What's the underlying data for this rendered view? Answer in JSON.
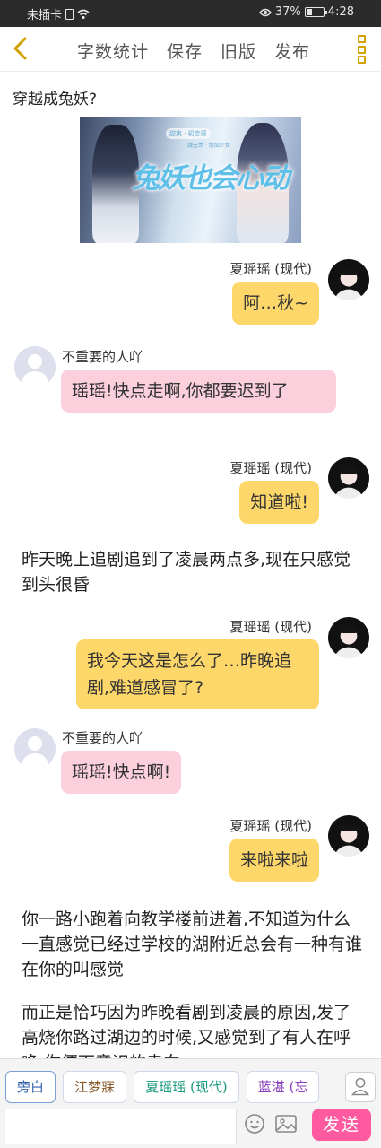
{
  "status_bar": {
    "carrier": "未插卡",
    "battery": "37%",
    "battery_level": 0.37,
    "time": "4:28"
  },
  "toolbar": {
    "back_icon": "chevron-left-icon",
    "actions": [
      "字数统计",
      "保存",
      "旧版",
      "发布"
    ],
    "more_icon": "more-vertical-icon",
    "accent_color": "#d3a200"
  },
  "story": {
    "title": "穿越成兔妖?",
    "cover_title": "兔妖也会心动",
    "cover_subtitle": "甜爽 · 初恋感",
    "cover_subtitle2": "魏无羡 · 兔仙少女"
  },
  "messages": [
    {
      "type": "right",
      "name": "夏瑶瑶 (现代)",
      "text": "阿…秋~"
    },
    {
      "type": "left",
      "name": "不重要的人吖",
      "text": "瑶瑶!快点走啊,你都要迟到了"
    },
    {
      "type": "right",
      "name": "夏瑶瑶 (现代)",
      "text": "知道啦!"
    },
    {
      "type": "narration",
      "text": "昨天晚上追剧追到了凌晨两点多,现在只感觉到头很昏"
    },
    {
      "type": "right",
      "name": "夏瑶瑶 (现代)",
      "text": "我今天这是怎么了…昨晚追剧,难道感冒了?"
    },
    {
      "type": "left",
      "name": "不重要的人吖",
      "text": "瑶瑶!快点啊!"
    },
    {
      "type": "right",
      "name": "夏瑶瑶 (现代)",
      "text": "来啦来啦"
    },
    {
      "type": "narration",
      "text": "你一路小跑着向教学楼前进着,不知道为什么一直感觉已经过学校的湖附近总会有一种有谁在你的叫感觉"
    },
    {
      "type": "narration",
      "text": "而正是恰巧因为昨晚看剧到凌晨的原因,发了高烧你路过湖边的时候,又感觉到了有人在呼唤,你便下意识的走向"
    }
  ],
  "bottom": {
    "characters": [
      "旁白",
      "江梦寐",
      "夏瑶瑶 (现代)",
      "蓝湛 (忘"
    ],
    "send_label": "发送",
    "send_color": "#ff5aa0",
    "icons": [
      "user-icon",
      "emoji-icon",
      "image-icon"
    ]
  }
}
